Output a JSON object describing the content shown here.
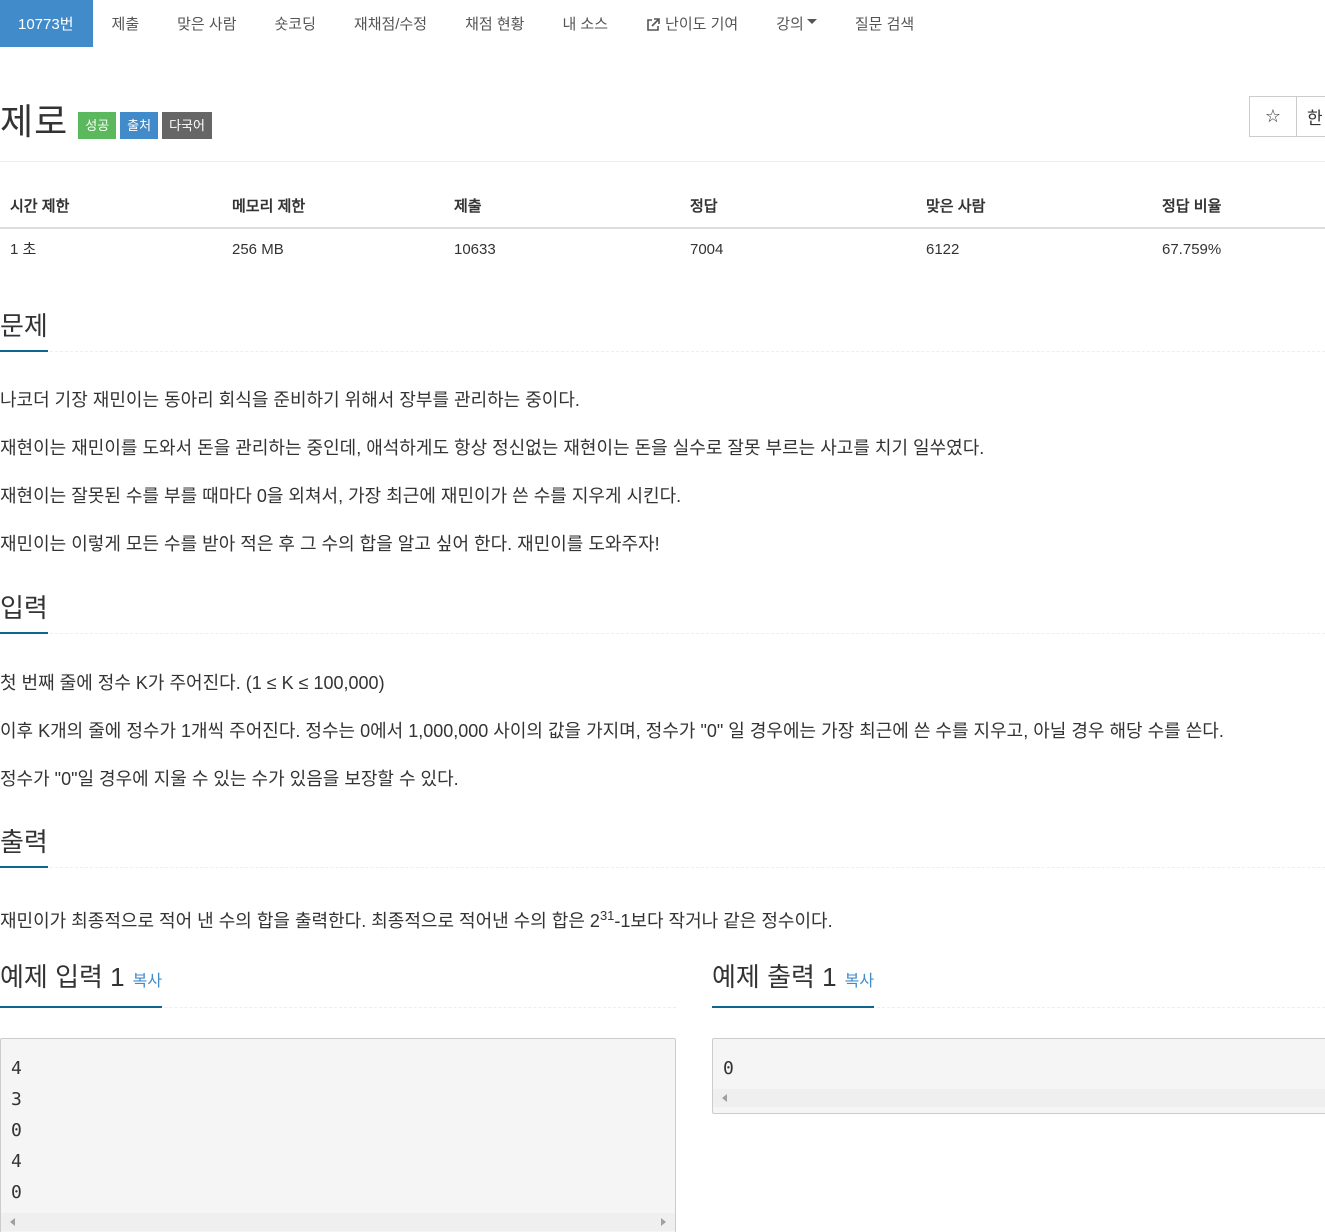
{
  "nav": {
    "tabs": [
      {
        "label": "10773번",
        "active": true
      },
      {
        "label": "제출"
      },
      {
        "label": "맞은 사람"
      },
      {
        "label": "숏코딩"
      },
      {
        "label": "재채점/수정"
      },
      {
        "label": "채점 현황"
      },
      {
        "label": "내 소스"
      },
      {
        "label": "난이도 기여",
        "icon": "external-link-icon"
      },
      {
        "label": "강의",
        "icon": "caret-down-icon"
      },
      {
        "label": "질문 검색"
      }
    ]
  },
  "problem": {
    "title": "제로",
    "badges": [
      "성공",
      "출처",
      "다국어"
    ],
    "star_icon": "☆",
    "lang_button": "한"
  },
  "info_table": {
    "headers": [
      "시간 제한",
      "메모리 제한",
      "제출",
      "정답",
      "맞은 사람",
      "정답 비율"
    ],
    "values": [
      "1 초",
      "256 MB",
      "10633",
      "7004",
      "6122",
      "67.759%"
    ]
  },
  "sections": {
    "problem": {
      "title": "문제",
      "paragraphs": [
        "나코더 기장 재민이는 동아리 회식을 준비하기 위해서 장부를 관리하는 중이다.",
        "재현이는 재민이를 도와서 돈을 관리하는 중인데, 애석하게도 항상 정신없는 재현이는 돈을 실수로 잘못 부르는 사고를 치기 일쑤였다.",
        "재현이는 잘못된 수를 부를 때마다 0을 외쳐서, 가장 최근에 재민이가 쓴 수를 지우게 시킨다.",
        "재민이는 이렇게 모든 수를 받아 적은 후 그 수의 합을 알고 싶어 한다. 재민이를 도와주자!"
      ]
    },
    "input": {
      "title": "입력",
      "paragraphs": [
        "첫 번째 줄에 정수 K가 주어진다. (1 ≤ K ≤ 100,000)",
        "이후 K개의 줄에 정수가 1개씩 주어진다. 정수는 0에서 1,000,000 사이의 값을 가지며, 정수가 \"0\" 일 경우에는 가장 최근에 쓴 수를 지우고, 아닐 경우 해당 수를 쓴다.",
        "정수가 \"0\"일 경우에 지울 수 있는 수가 있음을 보장할 수 있다."
      ]
    },
    "output": {
      "title": "출력",
      "text_before": "재민이가 최종적으로 적어 낸 수의 합을 출력한다. 최종적으로 적어낸 수의 합은 2",
      "superscript": "31",
      "text_after": "-1보다 작거나 같은 정수이다."
    }
  },
  "samples": {
    "input": {
      "title": "예제 입력 1",
      "copy": "복사",
      "lines": [
        "4",
        "3",
        "0",
        "4",
        "0"
      ]
    },
    "output": {
      "title": "예제 출력 1",
      "copy": "복사",
      "lines": [
        "0"
      ]
    }
  }
}
